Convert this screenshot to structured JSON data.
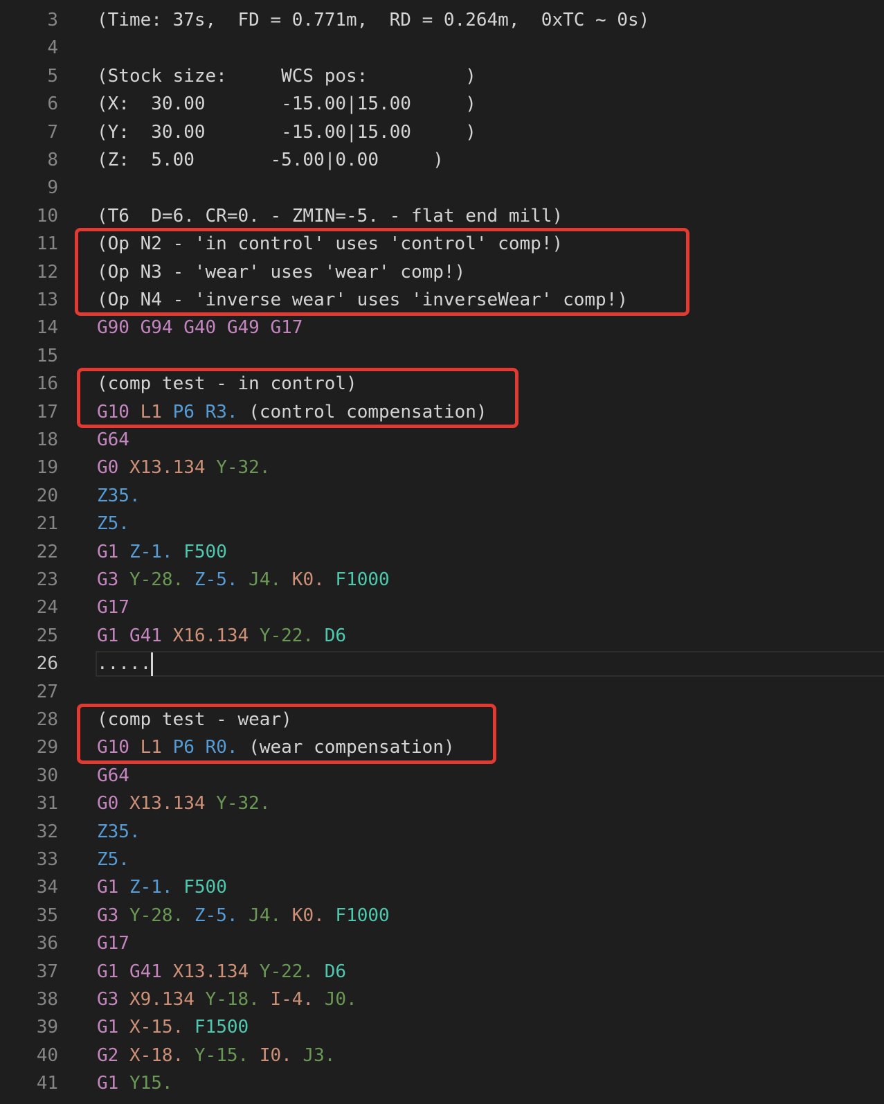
{
  "colors": {
    "background": "#1e1e1e",
    "line_number": "#858585",
    "line_number_active": "#c6c6c6",
    "plain": "#d4d4d4",
    "g_code": "#c586c0",
    "x_coord": "#ce9178",
    "y_coord": "#6a9955",
    "z_coord": "#569cd6",
    "feed": "#4ec9b0",
    "annotation_box": "#e03a33"
  },
  "editor": {
    "first_line_index": 3,
    "active_line_number": "26",
    "lines": [
      {
        "n": "3",
        "tokens": [
          {
            "t": "(Time: 37s,  FD = 0.771m,  RD = 0.264m,  0xTC ~ 0s)",
            "c": "plain"
          }
        ]
      },
      {
        "n": "4",
        "tokens": []
      },
      {
        "n": "5",
        "tokens": [
          {
            "t": "(Stock size:     WCS pos:         )",
            "c": "plain"
          }
        ]
      },
      {
        "n": "6",
        "tokens": [
          {
            "t": "(X:  30.00       -15.00|15.00     )",
            "c": "plain"
          }
        ]
      },
      {
        "n": "7",
        "tokens": [
          {
            "t": "(Y:  30.00       -15.00|15.00     )",
            "c": "plain"
          }
        ]
      },
      {
        "n": "8",
        "tokens": [
          {
            "t": "(Z:  5.00       -5.00|0.00     )",
            "c": "plain"
          }
        ]
      },
      {
        "n": "9",
        "tokens": []
      },
      {
        "n": "10",
        "tokens": [
          {
            "t": "(T6  D=6. CR=0. - ZMIN=-5. - flat end mill)",
            "c": "plain"
          }
        ]
      },
      {
        "n": "11",
        "tokens": [
          {
            "t": "(Op N2 - 'in control' uses 'control' comp!)",
            "c": "plain"
          }
        ]
      },
      {
        "n": "12",
        "tokens": [
          {
            "t": "(Op N3 - 'wear' uses 'wear' comp!)",
            "c": "plain"
          }
        ]
      },
      {
        "n": "13",
        "tokens": [
          {
            "t": "(Op N4 - 'inverse wear' uses 'inverseWear' comp!)",
            "c": "plain"
          }
        ]
      },
      {
        "n": "14",
        "tokens": [
          {
            "t": "G90 G94 G40 G49 G17",
            "c": "g_code"
          }
        ]
      },
      {
        "n": "15",
        "tokens": []
      },
      {
        "n": "16",
        "tokens": [
          {
            "t": "(comp test - in control)",
            "c": "plain"
          }
        ]
      },
      {
        "n": "17",
        "tokens": [
          {
            "t": "G10 ",
            "c": "g_code"
          },
          {
            "t": "L1 ",
            "c": "x_coord"
          },
          {
            "t": "P6 ",
            "c": "z_coord"
          },
          {
            "t": "R3. ",
            "c": "z_coord"
          },
          {
            "t": "(control compensation)",
            "c": "plain"
          }
        ]
      },
      {
        "n": "18",
        "tokens": [
          {
            "t": "G64",
            "c": "g_code"
          }
        ]
      },
      {
        "n": "19",
        "tokens": [
          {
            "t": "G0 ",
            "c": "g_code"
          },
          {
            "t": "X13.134 ",
            "c": "x_coord"
          },
          {
            "t": "Y-32.",
            "c": "y_coord"
          }
        ]
      },
      {
        "n": "20",
        "tokens": [
          {
            "t": "Z35.",
            "c": "z_coord"
          }
        ]
      },
      {
        "n": "21",
        "tokens": [
          {
            "t": "Z5.",
            "c": "z_coord"
          }
        ]
      },
      {
        "n": "22",
        "tokens": [
          {
            "t": "G1 ",
            "c": "g_code"
          },
          {
            "t": "Z-1. ",
            "c": "z_coord"
          },
          {
            "t": "F500",
            "c": "feed"
          }
        ]
      },
      {
        "n": "23",
        "tokens": [
          {
            "t": "G3 ",
            "c": "g_code"
          },
          {
            "t": "Y-28. ",
            "c": "y_coord"
          },
          {
            "t": "Z-5. ",
            "c": "z_coord"
          },
          {
            "t": "J4. ",
            "c": "y_coord"
          },
          {
            "t": "K0. ",
            "c": "x_coord"
          },
          {
            "t": "F1000",
            "c": "feed"
          }
        ]
      },
      {
        "n": "24",
        "tokens": [
          {
            "t": "G17",
            "c": "g_code"
          }
        ]
      },
      {
        "n": "25",
        "tokens": [
          {
            "t": "G1 G41 ",
            "c": "g_code"
          },
          {
            "t": "X16.134 ",
            "c": "x_coord"
          },
          {
            "t": "Y-22. ",
            "c": "y_coord"
          },
          {
            "t": "D6",
            "c": "feed"
          }
        ]
      },
      {
        "n": "26",
        "tokens": [
          {
            "t": ".....",
            "c": "plain"
          }
        ],
        "active": true
      },
      {
        "n": "27",
        "tokens": []
      },
      {
        "n": "28",
        "tokens": [
          {
            "t": "(comp test - wear)",
            "c": "plain"
          }
        ]
      },
      {
        "n": "29",
        "tokens": [
          {
            "t": "G10 ",
            "c": "g_code"
          },
          {
            "t": "L1 ",
            "c": "x_coord"
          },
          {
            "t": "P6 ",
            "c": "z_coord"
          },
          {
            "t": "R0. ",
            "c": "z_coord"
          },
          {
            "t": "(wear compensation)",
            "c": "plain"
          }
        ]
      },
      {
        "n": "30",
        "tokens": [
          {
            "t": "G64",
            "c": "g_code"
          }
        ]
      },
      {
        "n": "31",
        "tokens": [
          {
            "t": "G0 ",
            "c": "g_code"
          },
          {
            "t": "X13.134 ",
            "c": "x_coord"
          },
          {
            "t": "Y-32.",
            "c": "y_coord"
          }
        ]
      },
      {
        "n": "32",
        "tokens": [
          {
            "t": "Z35.",
            "c": "z_coord"
          }
        ]
      },
      {
        "n": "33",
        "tokens": [
          {
            "t": "Z5.",
            "c": "z_coord"
          }
        ]
      },
      {
        "n": "34",
        "tokens": [
          {
            "t": "G1 ",
            "c": "g_code"
          },
          {
            "t": "Z-1. ",
            "c": "z_coord"
          },
          {
            "t": "F500",
            "c": "feed"
          }
        ]
      },
      {
        "n": "35",
        "tokens": [
          {
            "t": "G3 ",
            "c": "g_code"
          },
          {
            "t": "Y-28. ",
            "c": "y_coord"
          },
          {
            "t": "Z-5. ",
            "c": "z_coord"
          },
          {
            "t": "J4. ",
            "c": "y_coord"
          },
          {
            "t": "K0. ",
            "c": "x_coord"
          },
          {
            "t": "F1000",
            "c": "feed"
          }
        ]
      },
      {
        "n": "36",
        "tokens": [
          {
            "t": "G17",
            "c": "g_code"
          }
        ]
      },
      {
        "n": "37",
        "tokens": [
          {
            "t": "G1 G41 ",
            "c": "g_code"
          },
          {
            "t": "X13.134 ",
            "c": "x_coord"
          },
          {
            "t": "Y-22. ",
            "c": "y_coord"
          },
          {
            "t": "D6",
            "c": "feed"
          }
        ]
      },
      {
        "n": "38",
        "tokens": [
          {
            "t": "G3 ",
            "c": "g_code"
          },
          {
            "t": "X9.134 ",
            "c": "x_coord"
          },
          {
            "t": "Y-18. ",
            "c": "y_coord"
          },
          {
            "t": "I-4. ",
            "c": "x_coord"
          },
          {
            "t": "J0.",
            "c": "y_coord"
          }
        ]
      },
      {
        "n": "39",
        "tokens": [
          {
            "t": "G1 ",
            "c": "g_code"
          },
          {
            "t": "X-15. ",
            "c": "x_coord"
          },
          {
            "t": "F1500",
            "c": "feed"
          }
        ]
      },
      {
        "n": "40",
        "tokens": [
          {
            "t": "G2 ",
            "c": "g_code"
          },
          {
            "t": "X-18. ",
            "c": "x_coord"
          },
          {
            "t": "Y-15. ",
            "c": "y_coord"
          },
          {
            "t": "I0. ",
            "c": "x_coord"
          },
          {
            "t": "J3.",
            "c": "y_coord"
          }
        ]
      },
      {
        "n": "41",
        "tokens": [
          {
            "t": "G1 ",
            "c": "g_code"
          },
          {
            "t": "Y15.",
            "c": "y_coord"
          }
        ]
      }
    ]
  },
  "annotations": [
    {
      "name": "op-comp-notes-box",
      "from": "11",
      "to": "13"
    },
    {
      "name": "in-control-comp-box",
      "from": "16",
      "to": "17"
    },
    {
      "name": "wear-comp-box",
      "from": "28",
      "to": "29"
    }
  ]
}
